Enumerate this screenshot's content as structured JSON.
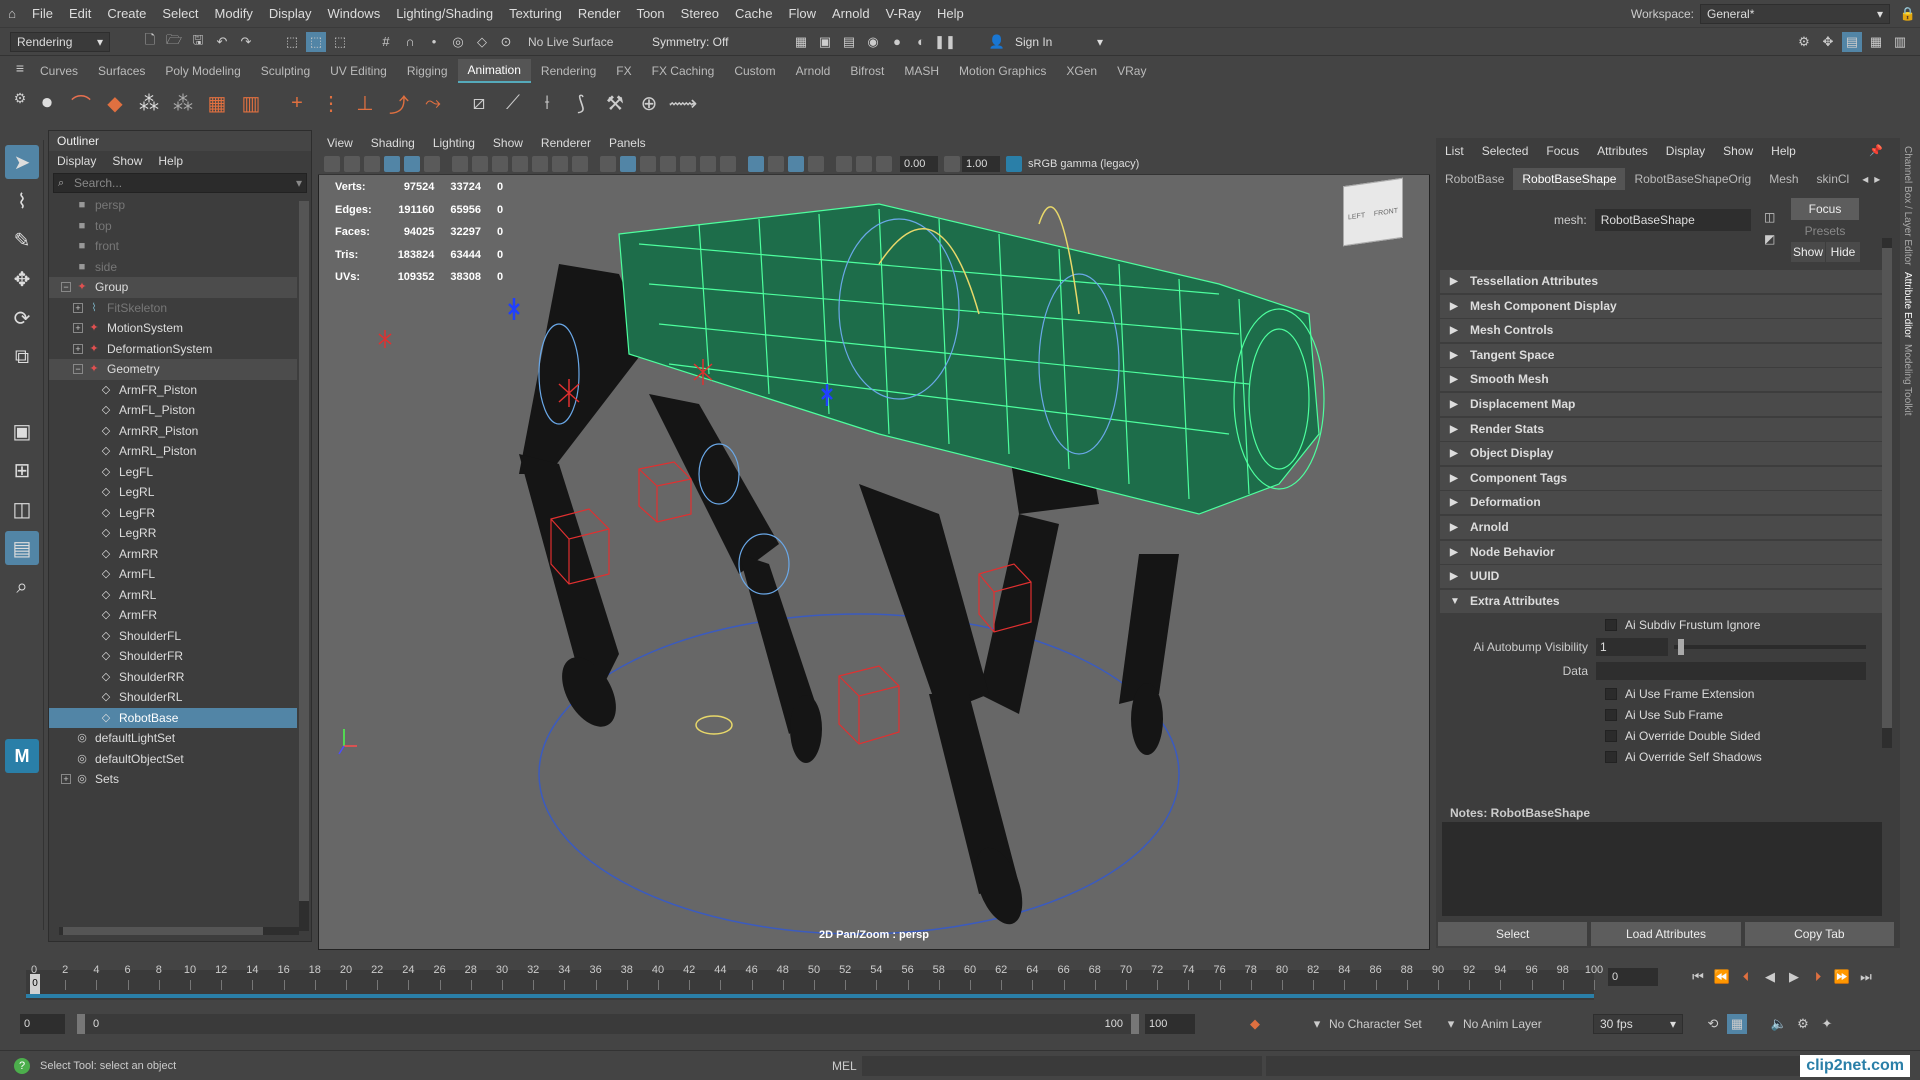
{
  "menubar": {
    "items": [
      "File",
      "Edit",
      "Create",
      "Select",
      "Modify",
      "Display",
      "Windows",
      "Lighting/Shading",
      "Texturing",
      "Render",
      "Toon",
      "Stereo",
      "Cache",
      "Flow",
      "Arnold",
      "V-Ray",
      "Help"
    ],
    "workspace_label": "Workspace:",
    "workspace_value": "General*"
  },
  "statusline": {
    "menu_set": "Rendering",
    "live_surface": "No Live Surface",
    "symmetry": "Symmetry: Off",
    "sign_in": "Sign In"
  },
  "shelf": {
    "tabs": [
      "Curves",
      "Surfaces",
      "Poly Modeling",
      "Sculpting",
      "UV Editing",
      "Rigging",
      "Animation",
      "Rendering",
      "FX",
      "FX Caching",
      "Custom",
      "Arnold",
      "Bifrost",
      "MASH",
      "Motion Graphics",
      "XGen",
      "VRay"
    ],
    "active_tab": "Animation"
  },
  "outliner": {
    "title": "Outliner",
    "menu": [
      "Display",
      "Show",
      "Help"
    ],
    "search_placeholder": "Search...",
    "items": [
      {
        "label": "persp",
        "icon": "camera-icon",
        "indent": 1,
        "dim": true
      },
      {
        "label": "top",
        "icon": "camera-icon",
        "indent": 1,
        "dim": true
      },
      {
        "label": "front",
        "icon": "camera-icon",
        "indent": 1,
        "dim": true
      },
      {
        "label": "side",
        "icon": "camera-icon",
        "indent": 1,
        "dim": true
      },
      {
        "label": "Group",
        "icon": "joint-icon",
        "indent": 1,
        "exp": "-",
        "grp": true
      },
      {
        "label": "FitSkeleton",
        "icon": "skeleton-icon",
        "indent": 2,
        "exp": "+",
        "dim": true
      },
      {
        "label": "MotionSystem",
        "icon": "joint-icon",
        "indent": 2,
        "exp": "+"
      },
      {
        "label": "DeformationSystem",
        "icon": "joint-icon",
        "indent": 2,
        "exp": "+"
      },
      {
        "label": "Geometry",
        "icon": "joint-icon",
        "indent": 2,
        "exp": "-",
        "grp": true
      },
      {
        "label": "ArmFR_Piston",
        "icon": "mesh-icon",
        "indent": 3
      },
      {
        "label": "ArmFL_Piston",
        "icon": "mesh-icon",
        "indent": 3
      },
      {
        "label": "ArmRR_Piston",
        "icon": "mesh-icon",
        "indent": 3
      },
      {
        "label": "ArmRL_Piston",
        "icon": "mesh-icon",
        "indent": 3
      },
      {
        "label": "LegFL",
        "icon": "mesh-icon",
        "indent": 3
      },
      {
        "label": "LegRL",
        "icon": "mesh-icon",
        "indent": 3
      },
      {
        "label": "LegFR",
        "icon": "mesh-icon",
        "indent": 3
      },
      {
        "label": "LegRR",
        "icon": "mesh-icon",
        "indent": 3
      },
      {
        "label": "ArmRR",
        "icon": "mesh-icon",
        "indent": 3
      },
      {
        "label": "ArmFL",
        "icon": "mesh-icon",
        "indent": 3
      },
      {
        "label": "ArmRL",
        "icon": "mesh-icon",
        "indent": 3
      },
      {
        "label": "ArmFR",
        "icon": "mesh-icon",
        "indent": 3
      },
      {
        "label": "ShoulderFL",
        "icon": "mesh-icon",
        "indent": 3
      },
      {
        "label": "ShoulderFR",
        "icon": "mesh-icon",
        "indent": 3
      },
      {
        "label": "ShoulderRR",
        "icon": "mesh-icon",
        "indent": 3
      },
      {
        "label": "ShoulderRL",
        "icon": "mesh-icon",
        "indent": 3
      },
      {
        "label": "RobotBase",
        "icon": "mesh-icon",
        "indent": 3,
        "hl": true
      },
      {
        "label": "defaultLightSet",
        "icon": "set-icon",
        "indent": 1
      },
      {
        "label": "defaultObjectSet",
        "icon": "set-icon",
        "indent": 1
      },
      {
        "label": "Sets",
        "icon": "set-icon",
        "indent": 1,
        "exp": "+"
      }
    ]
  },
  "viewport": {
    "menu": [
      "View",
      "Shading",
      "Lighting",
      "Show",
      "Renderer",
      "Panels"
    ],
    "exposure": "0.00",
    "gamma": "1.00",
    "color_space": "sRGB gamma (legacy)",
    "hud": [
      {
        "label": "Verts:",
        "a": "97524",
        "b": "33724",
        "c": "0"
      },
      {
        "label": "Edges:",
        "a": "191160",
        "b": "65956",
        "c": "0"
      },
      {
        "label": "Faces:",
        "a": "94025",
        "b": "32297",
        "c": "0"
      },
      {
        "label": "Tris:",
        "a": "183824",
        "b": "63444",
        "c": "0"
      },
      {
        "label": "UVs:",
        "a": "109352",
        "b": "38308",
        "c": "0"
      }
    ],
    "camera_label": "2D Pan/Zoom : persp",
    "cube_left": "LEFT",
    "cube_front": "FRONT"
  },
  "attribute_editor": {
    "menu": [
      "List",
      "Selected",
      "Focus",
      "Attributes",
      "Display",
      "Show",
      "Help"
    ],
    "tabs": [
      "RobotBase",
      "RobotBaseShape",
      "RobotBaseShapeOrig",
      "Mesh",
      "skinCl"
    ],
    "active_tab": "RobotBaseShape",
    "mesh_label": "mesh:",
    "mesh_value": "RobotBaseShape",
    "focus": "Focus",
    "presets": "Presets",
    "show": "Show",
    "hide": "Hide",
    "sections": [
      "Tessellation Attributes",
      "Mesh Component Display",
      "Mesh Controls",
      "Tangent Space",
      "Smooth Mesh",
      "Displacement Map",
      "Render Stats",
      "Object Display",
      "Component Tags",
      "Deformation",
      "Arnold",
      "Node Behavior",
      "UUID",
      "Extra Attributes"
    ],
    "extra": {
      "subdiv_frustum": "Ai Subdiv Frustum Ignore",
      "autobump_label": "Ai Autobump Visibility",
      "autobump_value": "1",
      "autobump_fraction": 0.02,
      "data_label": "Data",
      "checks": [
        "Ai Use Frame Extension",
        "Ai Use Sub Frame",
        "Ai Override Double Sided",
        "Ai Override Self Shadows"
      ]
    },
    "notes_label": "Notes:  RobotBaseShape",
    "buttons": [
      "Select",
      "Load Attributes",
      "Copy Tab"
    ],
    "side_tabs": [
      "Channel Box / Layer Editor",
      "Attribute Editor",
      "Modeling Toolkit"
    ]
  },
  "timeline": {
    "ticks": [
      "0",
      "2",
      "4",
      "6",
      "8",
      "10",
      "12",
      "14",
      "16",
      "18",
      "20",
      "22",
      "24",
      "26",
      "28",
      "30",
      "32",
      "34",
      "36",
      "38",
      "40",
      "42",
      "44",
      "46",
      "48",
      "50",
      "52",
      "54",
      "56",
      "58",
      "60",
      "62",
      "64",
      "66",
      "68",
      "70",
      "72",
      "74",
      "76",
      "78",
      "80",
      "82",
      "84",
      "86",
      "88",
      "90",
      "92",
      "94",
      "96",
      "98",
      "100"
    ],
    "current_frame": "0",
    "current_marker": "0"
  },
  "range": {
    "start": "0",
    "inner_start": "0",
    "inner_end": "100",
    "end": "100",
    "character_set": "No Character Set",
    "anim_layer": "No Anim Layer",
    "fps": "30 fps"
  },
  "helpline": {
    "message": "Select Tool: select an object",
    "mel": "MEL",
    "watermark": "clip2net.com"
  }
}
